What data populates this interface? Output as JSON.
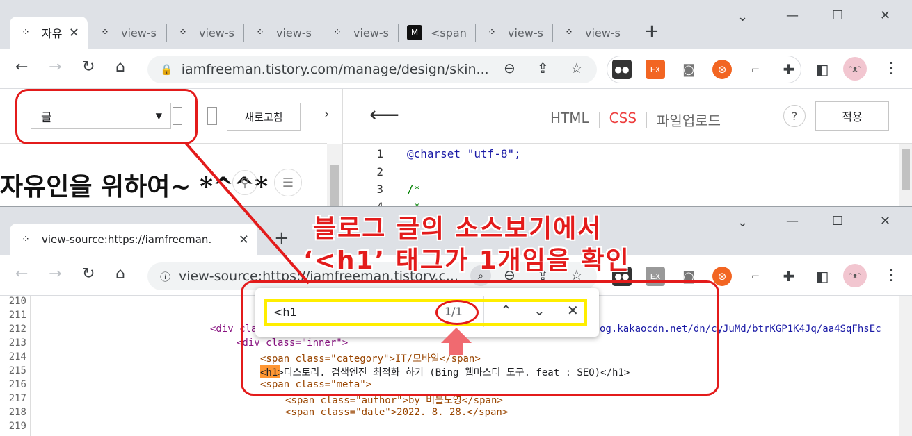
{
  "window1": {
    "tabs": [
      {
        "label": "자유",
        "active": true
      },
      {
        "label": "view-s"
      },
      {
        "label": "view-s"
      },
      {
        "label": "view-s"
      },
      {
        "label": "view-s"
      },
      {
        "label": "<span"
      },
      {
        "label": "view-s"
      },
      {
        "label": "view-s"
      }
    ],
    "url": "iamfreeman.tistory.com/manage/design/skin...",
    "left_panel": {
      "select_value": "글",
      "refresh_label": "새로고침",
      "preview_title": "자유인을 위하여~ *^^*"
    },
    "editor": {
      "tabs": [
        "HTML",
        "CSS",
        "파일업로드"
      ],
      "active_tab": "CSS",
      "help_label": "?",
      "apply_label": "적용",
      "lines": [
        {
          "num": "1",
          "text": "@charset \"utf-8\";"
        },
        {
          "num": "2",
          "text": ""
        },
        {
          "num": "3",
          "text": "/*"
        },
        {
          "num": "4",
          "text": " *"
        }
      ]
    }
  },
  "window2": {
    "tab_label": "view-source:https://iamfreeman.",
    "url": "view-source:https://iamfreeman.tistory.c...",
    "find": {
      "query": "<h1",
      "count": "1/1"
    },
    "source_lines": [
      {
        "num": "210",
        "text": ""
      },
      {
        "num": "211",
        "text": ""
      },
      {
        "num": "212",
        "text": "<div cla",
        "tail": "og.kakaocdn.net/dn/cyJuMd/btrKGP1K4Jq/aa4SqFhsEc"
      },
      {
        "num": "213",
        "text": "<div class=\"inner\">"
      },
      {
        "num": "214",
        "text": "<span class=\"category\">IT/모바일</span>"
      },
      {
        "num": "215",
        "text": "<h1>티스토리. 검색엔진 최적화 하기 (Bing 웹마스터 도구. feat : SEO)</h1>"
      },
      {
        "num": "216",
        "text": "<span class=\"meta\">"
      },
      {
        "num": "217",
        "text": "<span class=\"author\">by 버블노영</span>"
      },
      {
        "num": "218",
        "text": "<span class=\"date\">2022. 8. 28.</span>"
      },
      {
        "num": "219",
        "text": ""
      }
    ]
  },
  "annotation": {
    "line1": "블로그 글의 소스보기에서",
    "line2": "‘<h1’ 태그가 1개임을 확인"
  },
  "colors": {
    "annotation_red": "#e31b1b",
    "highlight_yellow": "#ffee00",
    "css_tab_red": "#ed3e3e"
  }
}
